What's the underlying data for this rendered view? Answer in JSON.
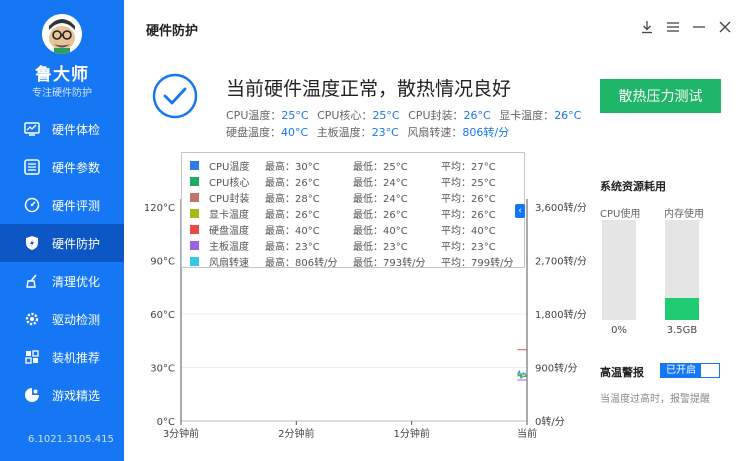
{
  "app": {
    "name": "鲁大师",
    "subtitle": "专注硬件防护",
    "version": "6.1021.3105.415"
  },
  "sidebar": {
    "items": [
      {
        "label": "硬件体检",
        "icon": "monitor-icon",
        "active": false
      },
      {
        "label": "硬件参数",
        "icon": "sliders-icon",
        "active": false
      },
      {
        "label": "硬件评测",
        "icon": "speedometer-icon",
        "active": false
      },
      {
        "label": "硬件防护",
        "icon": "shield-bolt-icon",
        "active": true
      },
      {
        "label": "清理优化",
        "icon": "broom-icon",
        "active": false
      },
      {
        "label": "驱动检测",
        "icon": "gear-icon",
        "active": false
      },
      {
        "label": "装机推荐",
        "icon": "puzzle-icon",
        "active": false
      },
      {
        "label": "游戏精选",
        "icon": "gamepad-icon",
        "active": false
      }
    ]
  },
  "header": {
    "title": "硬件防护"
  },
  "status": {
    "title": "当前硬件温度正常，散热情况良好",
    "line1": [
      {
        "label": "CPU温度：",
        "value": "25°C"
      },
      {
        "label": "CPU核心：",
        "value": "25°C"
      },
      {
        "label": "CPU封装：",
        "value": "26°C"
      },
      {
        "label": "显卡温度：",
        "value": "26°C"
      }
    ],
    "line2": [
      {
        "label": "硬盘温度：",
        "value": "40°C"
      },
      {
        "label": "主板温度：",
        "value": "23°C"
      },
      {
        "label": "风扇转速：",
        "value": "806转/分"
      }
    ],
    "stress_button": "散热压力测试"
  },
  "legend": {
    "rows": [
      {
        "name": "CPU温度",
        "max": "最高：30°C",
        "min": "最低：25°C",
        "avg": "平均：27°C",
        "color": "#2f7bea"
      },
      {
        "name": "CPU核心",
        "max": "最高：26°C",
        "min": "最低：24°C",
        "avg": "平均：25°C",
        "color": "#1faa62"
      },
      {
        "name": "CPU封装",
        "max": "最高：28°C",
        "min": "最低：24°C",
        "avg": "平均：26°C",
        "color": "#c0756a"
      },
      {
        "name": "显卡温度",
        "max": "最高：26°C",
        "min": "最低：26°C",
        "avg": "平均：26°C",
        "color": "#a8b817"
      },
      {
        "name": "硬盘温度",
        "max": "最高：40°C",
        "min": "最低：40°C",
        "avg": "平均：40°C",
        "color": "#ea4b44"
      },
      {
        "name": "主板温度",
        "max": "最高：23°C",
        "min": "最低：23°C",
        "avg": "平均：23°C",
        "color": "#9a63e0"
      },
      {
        "name": "风扇转速",
        "max": "最高：806转/分",
        "min": "最低：793转/分",
        "avg": "平均：799转/分",
        "color": "#36c7e8"
      }
    ]
  },
  "chart_data": {
    "type": "line",
    "x_ticks": [
      "3分钟前",
      "2分钟前",
      "1分钟前",
      "当前"
    ],
    "y_left": {
      "min": 0,
      "max": 120,
      "ticks": [
        "0°C",
        "30°C",
        "60°C",
        "90°C",
        "120°C"
      ],
      "tick_values": [
        0,
        30,
        60,
        90,
        120
      ]
    },
    "y_right": {
      "min": 0,
      "max": 3600,
      "ticks": [
        "0转/分",
        "900转/分",
        "1,800转/分",
        "2,700转/分",
        "3,600转/分"
      ],
      "tick_values": [
        0,
        900,
        1800,
        2700,
        3600
      ]
    },
    "grid": true,
    "x_range_seconds": [
      -180,
      0
    ],
    "series": [
      {
        "name": "CPU温度",
        "color": "#2f7bea",
        "axis": "left",
        "t": [
          -5,
          -4,
          -3,
          -2,
          -1,
          0
        ],
        "values": [
          26,
          28,
          25,
          27,
          26,
          25
        ]
      },
      {
        "name": "CPU核心",
        "color": "#1faa62",
        "axis": "left",
        "t": [
          -5,
          -4,
          -3,
          -2,
          -1,
          0
        ],
        "values": [
          25,
          26,
          24,
          25,
          25,
          25
        ]
      },
      {
        "name": "CPU封装",
        "color": "#c0756a",
        "axis": "left",
        "t": [
          -5,
          -4,
          -3,
          -2,
          -1,
          0
        ],
        "values": [
          26,
          27,
          26,
          26,
          26,
          26
        ]
      },
      {
        "name": "显卡温度",
        "color": "#a8b817",
        "axis": "left",
        "t": [
          -5,
          0
        ],
        "values": [
          26,
          26
        ]
      },
      {
        "name": "硬盘温度",
        "color": "#ea4b44",
        "axis": "left",
        "t": [
          -5,
          0
        ],
        "values": [
          40,
          40
        ]
      },
      {
        "name": "主板温度",
        "color": "#9a63e0",
        "axis": "left",
        "t": [
          -5,
          0
        ],
        "values": [
          23,
          23
        ]
      },
      {
        "name": "风扇转速",
        "color": "#36c7e8",
        "axis": "right",
        "t": [
          -5,
          -4,
          -3,
          -2,
          -1,
          0
        ],
        "values": [
          800,
          806,
          795,
          793,
          799,
          806
        ]
      }
    ]
  },
  "resources": {
    "title": "系统资源耗用",
    "cpu": {
      "label": "CPU使用",
      "value": "0%",
      "fraction": 0
    },
    "memory": {
      "label": "内存使用",
      "value": "3.5GB",
      "fraction": 0.22
    }
  },
  "alarm": {
    "label": "高温警报",
    "state": "已开启",
    "note": "当温度过高时，报警提醒"
  },
  "colors": {
    "sidebar": "#1677f5",
    "sidebar_active": "#0d56c5",
    "accent_green": "#1fb66a",
    "accent_blue": "#1677f5"
  }
}
